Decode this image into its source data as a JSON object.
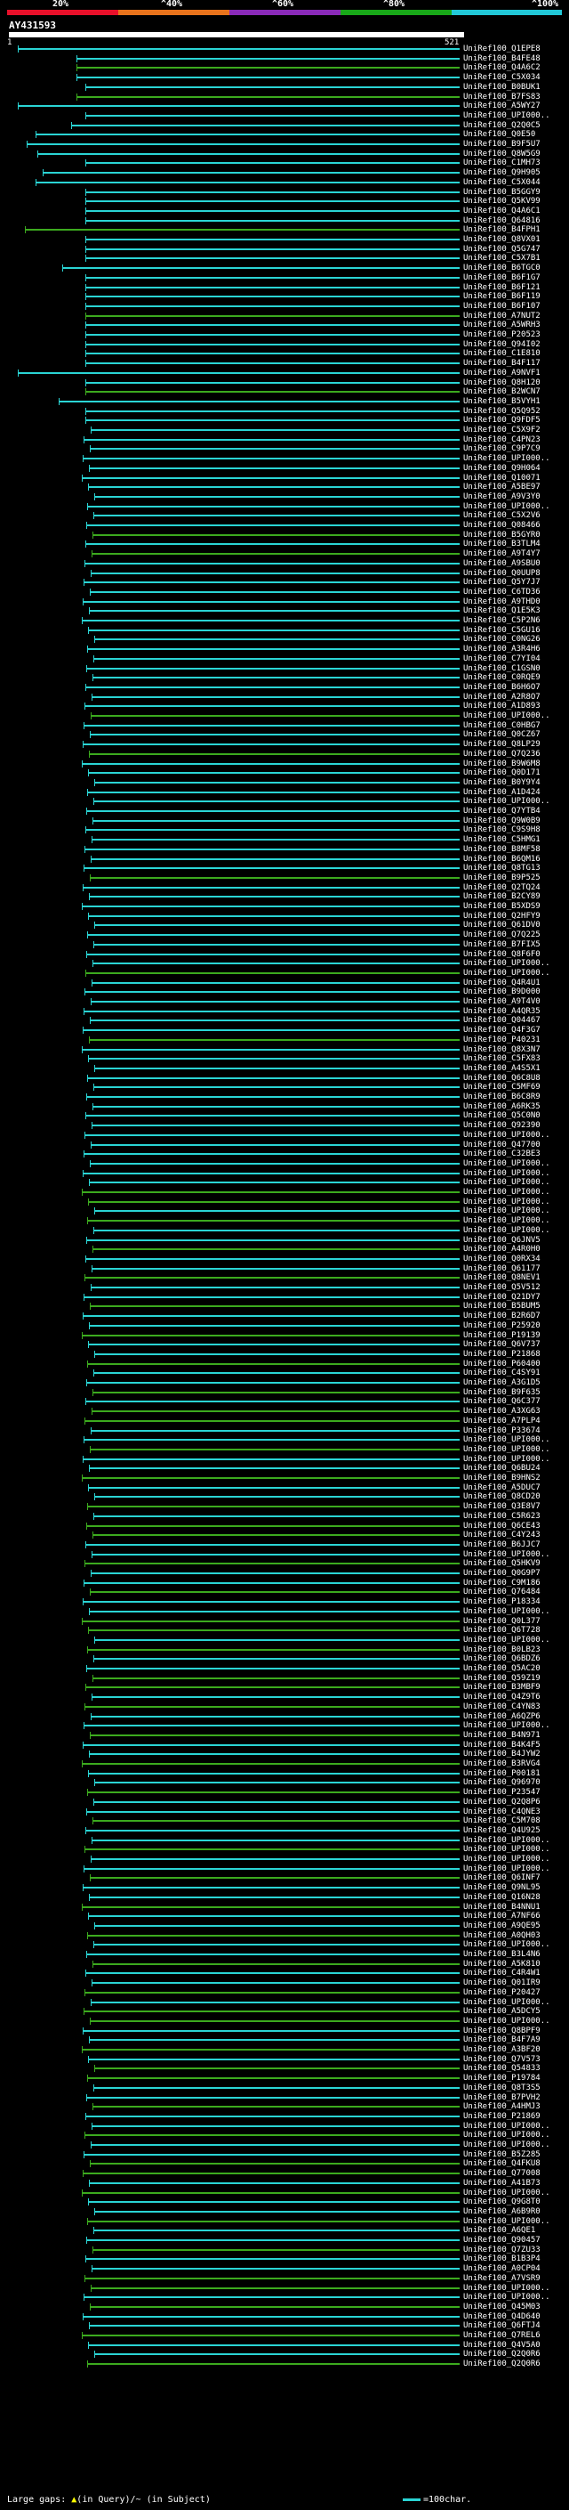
{
  "scale": {
    "labels": [
      "20%",
      "^40%",
      "^60%",
      "^80%",
      "^100%"
    ],
    "colors": [
      "#e8102a",
      "#e8731c",
      "#8a2ab8",
      "#18a818",
      "#22c8d8"
    ]
  },
  "query": {
    "id": "AY431593",
    "start": "1",
    "end": "521"
  },
  "colors": {
    "identity_high": "#2ad4d4",
    "identity_mid": "#3caa1e",
    "query_bar": "#ffffff",
    "background": "#000000"
  },
  "hits": [
    "UniRef100_Q1EPE8",
    "UniRef100_B4FE48",
    "UniRef100_Q4A6C2",
    "UniRef100_C5X034",
    "UniRef100_B0BUK1",
    "UniRef100_B7FS83",
    "UniRef100_A5WY27",
    "UniRef100_UPI000..",
    "UniRef100_Q2Q0C5",
    "UniRef100_Q0E50",
    "UniRef100_B9F5U7",
    "UniRef100_Q8W5G9",
    "UniRef100_C1MH73",
    "UniRef100_Q9H905",
    "UniRef100_C5X044",
    "UniRef100_B5GGY9",
    "UniRef100_Q5KV99",
    "UniRef100_Q4A6C1",
    "UniRef100_Q64816",
    "UniRef100_B4FPH1",
    "UniRef100_Q8VX01",
    "UniRef100_Q5G747",
    "UniRef100_C5X7B1",
    "UniRef100_B6TGC0",
    "UniRef100_B6F1G7",
    "UniRef100_B6F121",
    "UniRef100_B6F119",
    "UniRef100_B6F107",
    "UniRef100_A7NUT2",
    "UniRef100_A5WRH3",
    "UniRef100_P20523",
    "UniRef100_Q94I02",
    "UniRef100_C1E810",
    "UniRef100_B4F117",
    "UniRef100_A9NVF1",
    "UniRef100_Q8H120",
    "UniRef100_B2WCN7",
    "UniRef100_B5VYH1",
    "UniRef100_Q5Q952",
    "UniRef100_Q9FDF5",
    "UniRef100_C5X9F2",
    "UniRef100_C4PN23",
    "UniRef100_C9P7C9",
    "UniRef100_UPI000..",
    "UniRef100_Q9H064",
    "UniRef100_Q10071",
    "UniRef100_A5BE97",
    "UniRef100_A9V3Y0",
    "UniRef100_UPI000..",
    "UniRef100_C5X2V6",
    "UniRef100_Q08466",
    "UniRef100_B5GYR0",
    "UniRef100_B3TLM4",
    "UniRef100_A9T4Y7",
    "UniRef100_A9SBU0",
    "UniRef100_Q0UUP8",
    "UniRef100_Q5Y7J7",
    "UniRef100_C6TD36",
    "UniRef100_A9THD0",
    "UniRef100_Q1E5K3",
    "UniRef100_C5P2N6",
    "UniRef100_C5GU16",
    "UniRef100_C0NG26",
    "UniRef100_A3R4H6",
    "UniRef100_C7YI04",
    "UniRef100_C1GSN0",
    "UniRef100_C0RQE9",
    "UniRef100_B6H6O7",
    "UniRef100_A2R8O7",
    "UniRef100_A1D893",
    "UniRef100_UPI000..",
    "UniRef100_C0HBG7",
    "UniRef100_Q0CZ67",
    "UniRef100_Q8LP29",
    "UniRef100_Q7Q236",
    "UniRef100_B9W6M8",
    "UniRef100_Q0D171",
    "UniRef100_B0Y9Y4",
    "UniRef100_A1D424",
    "UniRef100_UPI000..",
    "UniRef100_Q7YTB4",
    "UniRef100_Q9W0B9",
    "UniRef100_C9S9H8",
    "UniRef100_C5HMG1",
    "UniRef100_B8MF58",
    "UniRef100_B6QM16",
    "UniRef100_Q8TG13",
    "UniRef100_B9P525",
    "UniRef100_Q2TQ24",
    "UniRef100_B2CY89",
    "UniRef100_B5XDS9",
    "UniRef100_Q2HFY9",
    "UniRef100_Q61DV0",
    "UniRef100_Q7Q225",
    "UniRef100_B7FIX5",
    "UniRef100_Q8F6F0",
    "UniRef100_UPI000..",
    "UniRef100_UPI000..",
    "UniRef100_Q4R4U1",
    "UniRef100_B9D000",
    "UniRef100_A9T4V0",
    "UniRef100_A4QR35",
    "UniRef100_Q04467",
    "UniRef100_Q4F3G7",
    "UniRef100_P40231",
    "UniRef100_Q8X3N7",
    "UniRef100_C5FX83",
    "UniRef100_A4S5X1",
    "UniRef100_Q6C8U8",
    "UniRef100_C5MF69",
    "UniRef100_B6C8R9",
    "UniRef100_A6RK35",
    "UniRef100_Q5C0N0",
    "UniRef100_Q92390",
    "UniRef100_UPI000..",
    "UniRef100_Q47700",
    "UniRef100_C32BE3",
    "UniRef100_UPI000..",
    "UniRef100_UPI000..",
    "UniRef100_UPI000..",
    "UniRef100_UPI000..",
    "UniRef100_UPI000..",
    "UniRef100_UPI000..",
    "UniRef100_UPI000..",
    "UniRef100_UPI000..",
    "UniRef100_Q6JNV5",
    "UniRef100_A4R0H0",
    "UniRef100_Q0RX34",
    "UniRef100_Q61177",
    "UniRef100_Q8NEV1",
    "UniRef100_Q5V512",
    "UniRef100_Q21DY7",
    "UniRef100_B5BUM5",
    "UniRef100_B2R6D7",
    "UniRef100_P25920",
    "UniRef100_P19139",
    "UniRef100_Q6V737",
    "UniRef100_P21868",
    "UniRef100_P60400",
    "UniRef100_C4SY91",
    "UniRef100_A3G1D5",
    "UniRef100_B9F635",
    "UniRef100_Q6C377",
    "UniRef100_A3XG63",
    "UniRef100_A7PLP4",
    "UniRef100_P33674",
    "UniRef100_UPI000..",
    "UniRef100_UPI000..",
    "UniRef100_UPI000..",
    "UniRef100_Q6BU24",
    "UniRef100_B9HNS2",
    "UniRef100_A5DUC7",
    "UniRef100_Q8CD20",
    "UniRef100_Q3E8V7",
    "UniRef100_C5R623",
    "UniRef100_Q6CE43",
    "UniRef100_C4Y243",
    "UniRef100_B6JJC7",
    "UniRef100_UPI000..",
    "UniRef100_Q5HKV9",
    "UniRef100_Q0G9P7",
    "UniRef100_C9M186",
    "UniRef100_Q76484",
    "UniRef100_P18334",
    "UniRef100_UPI000..",
    "UniRef100_Q0L377",
    "UniRef100_Q6T728",
    "UniRef100_UPI000..",
    "UniRef100_B0LB23",
    "UniRef100_Q6BDZ6",
    "UniRef100_Q5AC20",
    "UniRef100_Q59Z19",
    "UniRef100_B3MBF9",
    "UniRef100_Q4Z9T6",
    "UniRef100_C4YN83",
    "UniRef100_A6QZP6",
    "UniRef100_UPI000..",
    "UniRef100_B4N971",
    "UniRef100_B4K4F5",
    "UniRef100_B4JYW2",
    "UniRef100_B3RVG4",
    "UniRef100_P00181",
    "UniRef100_Q96970",
    "UniRef100_P23547",
    "UniRef100_Q2Q8P6",
    "UniRef100_C4QNE3",
    "UniRef100_C5M708",
    "UniRef100_Q4U925",
    "UniRef100_UPI000..",
    "UniRef100_UPI000..",
    "UniRef100_UPI000..",
    "UniRef100_UPI000..",
    "UniRef100_Q6INF7",
    "UniRef100_Q9NL95",
    "UniRef100_Q16N28",
    "UniRef100_B4NNU1",
    "UniRef100_A7NF66",
    "UniRef100_A9QE95",
    "UniRef100_A0QH03",
    "UniRef100_UPI000..",
    "UniRef100_B3L4N6",
    "UniRef100_A5K810",
    "UniRef100_C4R4W1",
    "UniRef100_Q01IR9",
    "UniRef100_P20427",
    "UniRef100_UPI000..",
    "UniRef100_A5DCY5",
    "UniRef100_UPI000..",
    "UniRef100_Q8BPF9",
    "UniRef100_B4F7A9",
    "UniRef100_A3BF20",
    "UniRef100_Q7V573",
    "UniRef100_Q54833",
    "UniRef100_P19784",
    "UniRef100_Q8T3S5",
    "UniRef100_B7PVH2",
    "UniRef100_A4HMJ3",
    "UniRef100_P21869",
    "UniRef100_UPI000..",
    "UniRef100_UPI000..",
    "UniRef100_UPI000..",
    "UniRef100_B5Z285",
    "UniRef100_Q4FKU8",
    "UniRef100_Q77008",
    "UniRef100_A41B73",
    "UniRef100_UPI000..",
    "UniRef100_Q9G8T0",
    "UniRef100_A6B9R0",
    "UniRef100_UPI000..",
    "UniRef100_A6QE1",
    "UniRef100_Q90457",
    "UniRef100_Q7ZU33",
    "UniRef100_B1B3P4",
    "UniRef100_A0CP04",
    "UniRef100_A7VSR9",
    "UniRef100_UPI000..",
    "UniRef100_UPI000..",
    "UniRef100_Q45M03",
    "UniRef100_Q4D640",
    "UniRef100_Q6FTJ4",
    "UniRef100_Q7REL6",
    "UniRef100_Q4V5A0",
    "UniRef100_Q2Q0R6",
    "UniRef100_Q2Q0R6"
  ],
  "footer": {
    "prefix": "Large gaps:",
    "query_marker": "▲",
    "query_text": "(in Query)/",
    "subject_marker": "~",
    "subject_text": "(in Subject)",
    "legend_text": "=100char."
  }
}
